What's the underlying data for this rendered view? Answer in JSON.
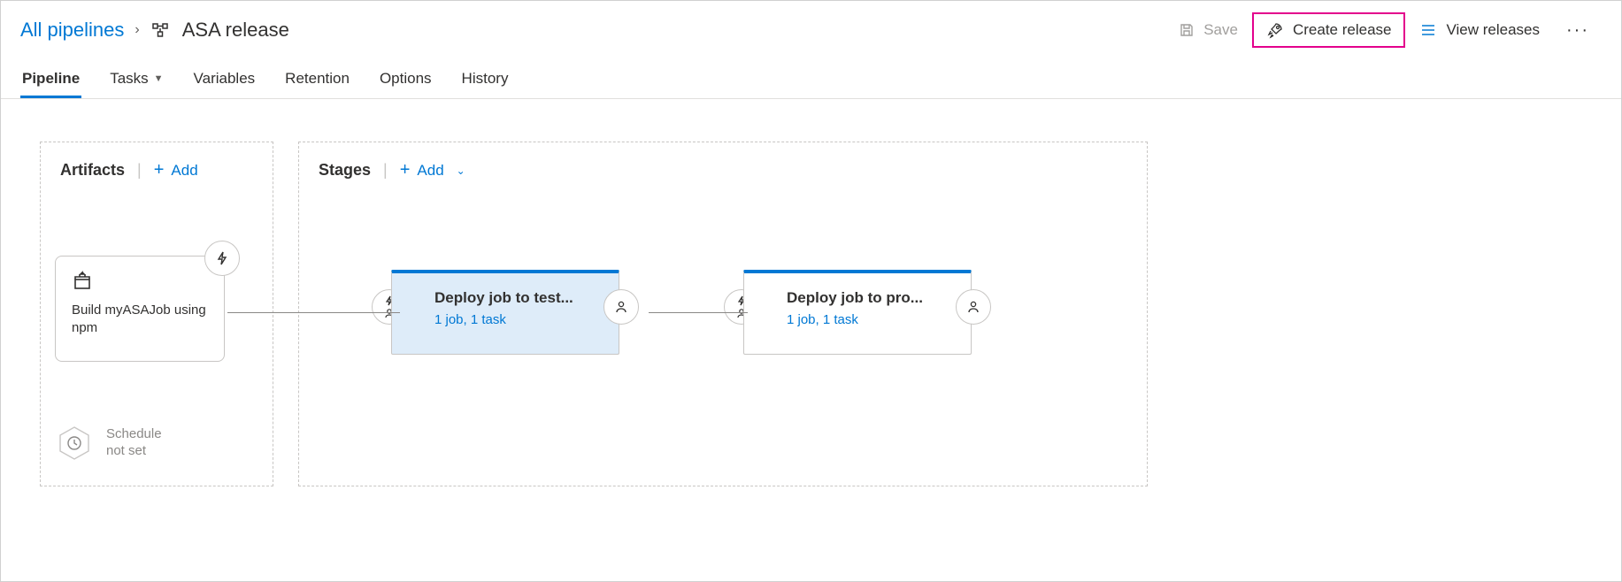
{
  "breadcrumb": {
    "root": "All pipelines",
    "title": "ASA release"
  },
  "actions": {
    "save": "Save",
    "create_release": "Create release",
    "view_releases": "View releases"
  },
  "tabs": [
    {
      "label": "Pipeline",
      "active": true
    },
    {
      "label": "Tasks",
      "has_dropdown": true
    },
    {
      "label": "Variables"
    },
    {
      "label": "Retention"
    },
    {
      "label": "Options"
    },
    {
      "label": "History"
    }
  ],
  "artifacts": {
    "title": "Artifacts",
    "add": "Add",
    "card_name": "Build myASAJob using npm",
    "schedule_label": "Schedule not set"
  },
  "stages": {
    "title": "Stages",
    "add": "Add",
    "items": [
      {
        "title": "Deploy job to test...",
        "sub": "1 job, 1 task",
        "selected": true
      },
      {
        "title": "Deploy job to pro...",
        "sub": "1 job, 1 task",
        "selected": false
      }
    ]
  }
}
